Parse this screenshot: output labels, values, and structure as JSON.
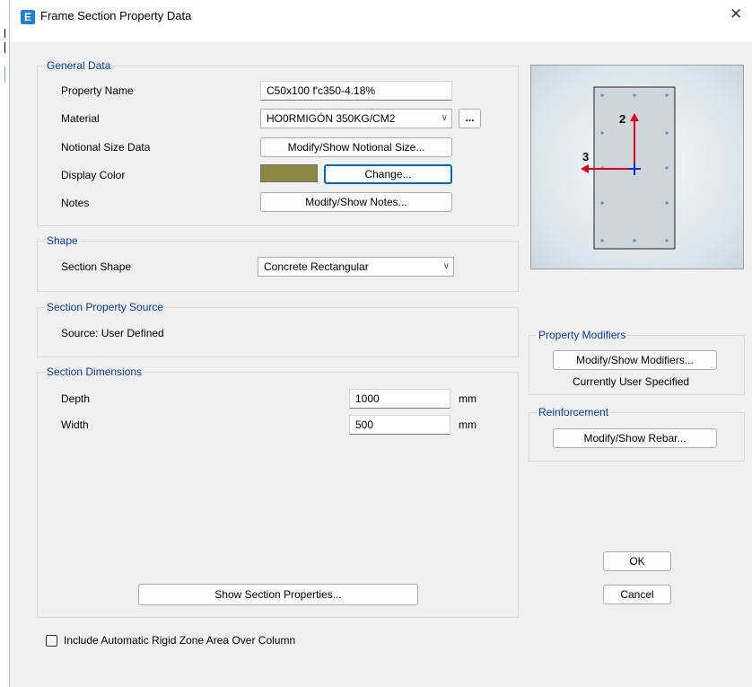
{
  "window": {
    "title": "Frame Section Property Data",
    "app_icon_letter": "E"
  },
  "general_data": {
    "group_label": "General Data",
    "property_name_label": "Property Name",
    "property_name_value": "C50x100 f'c350-4.18%",
    "material_label": "Material",
    "material_value": "HO0RMIGÓN 350KG/CM2",
    "material_more_label": "...",
    "notional_label": "Notional Size Data",
    "notional_button": "Modify/Show Notional Size...",
    "display_color_label": "Display Color",
    "display_color_hex": "#8c8843",
    "change_button": "Change...",
    "notes_label": "Notes",
    "notes_button": "Modify/Show Notes..."
  },
  "shape": {
    "group_label": "Shape",
    "section_shape_label": "Section Shape",
    "section_shape_value": "Concrete Rectangular"
  },
  "source": {
    "group_label": "Section Property Source",
    "source_text": "Source:  User Defined"
  },
  "dimensions": {
    "group_label": "Section Dimensions",
    "depth_label": "Depth",
    "depth_value": "1000",
    "width_label": "Width",
    "width_value": "500",
    "unit": "mm",
    "show_properties_button": "Show Section Properties..."
  },
  "preview": {
    "axis2_label": "2",
    "axis3_label": "3"
  },
  "modifiers": {
    "group_label": "Property Modifiers",
    "button": "Modify/Show Modifiers...",
    "status": "Currently User Specified"
  },
  "reinforcement": {
    "group_label": "Reinforcement",
    "button": "Modify/Show Rebar..."
  },
  "actions": {
    "ok": "OK",
    "cancel": "Cancel"
  },
  "rigid_zone": {
    "label": "Include Automatic Rigid Zone Area Over Column",
    "checked": false
  }
}
